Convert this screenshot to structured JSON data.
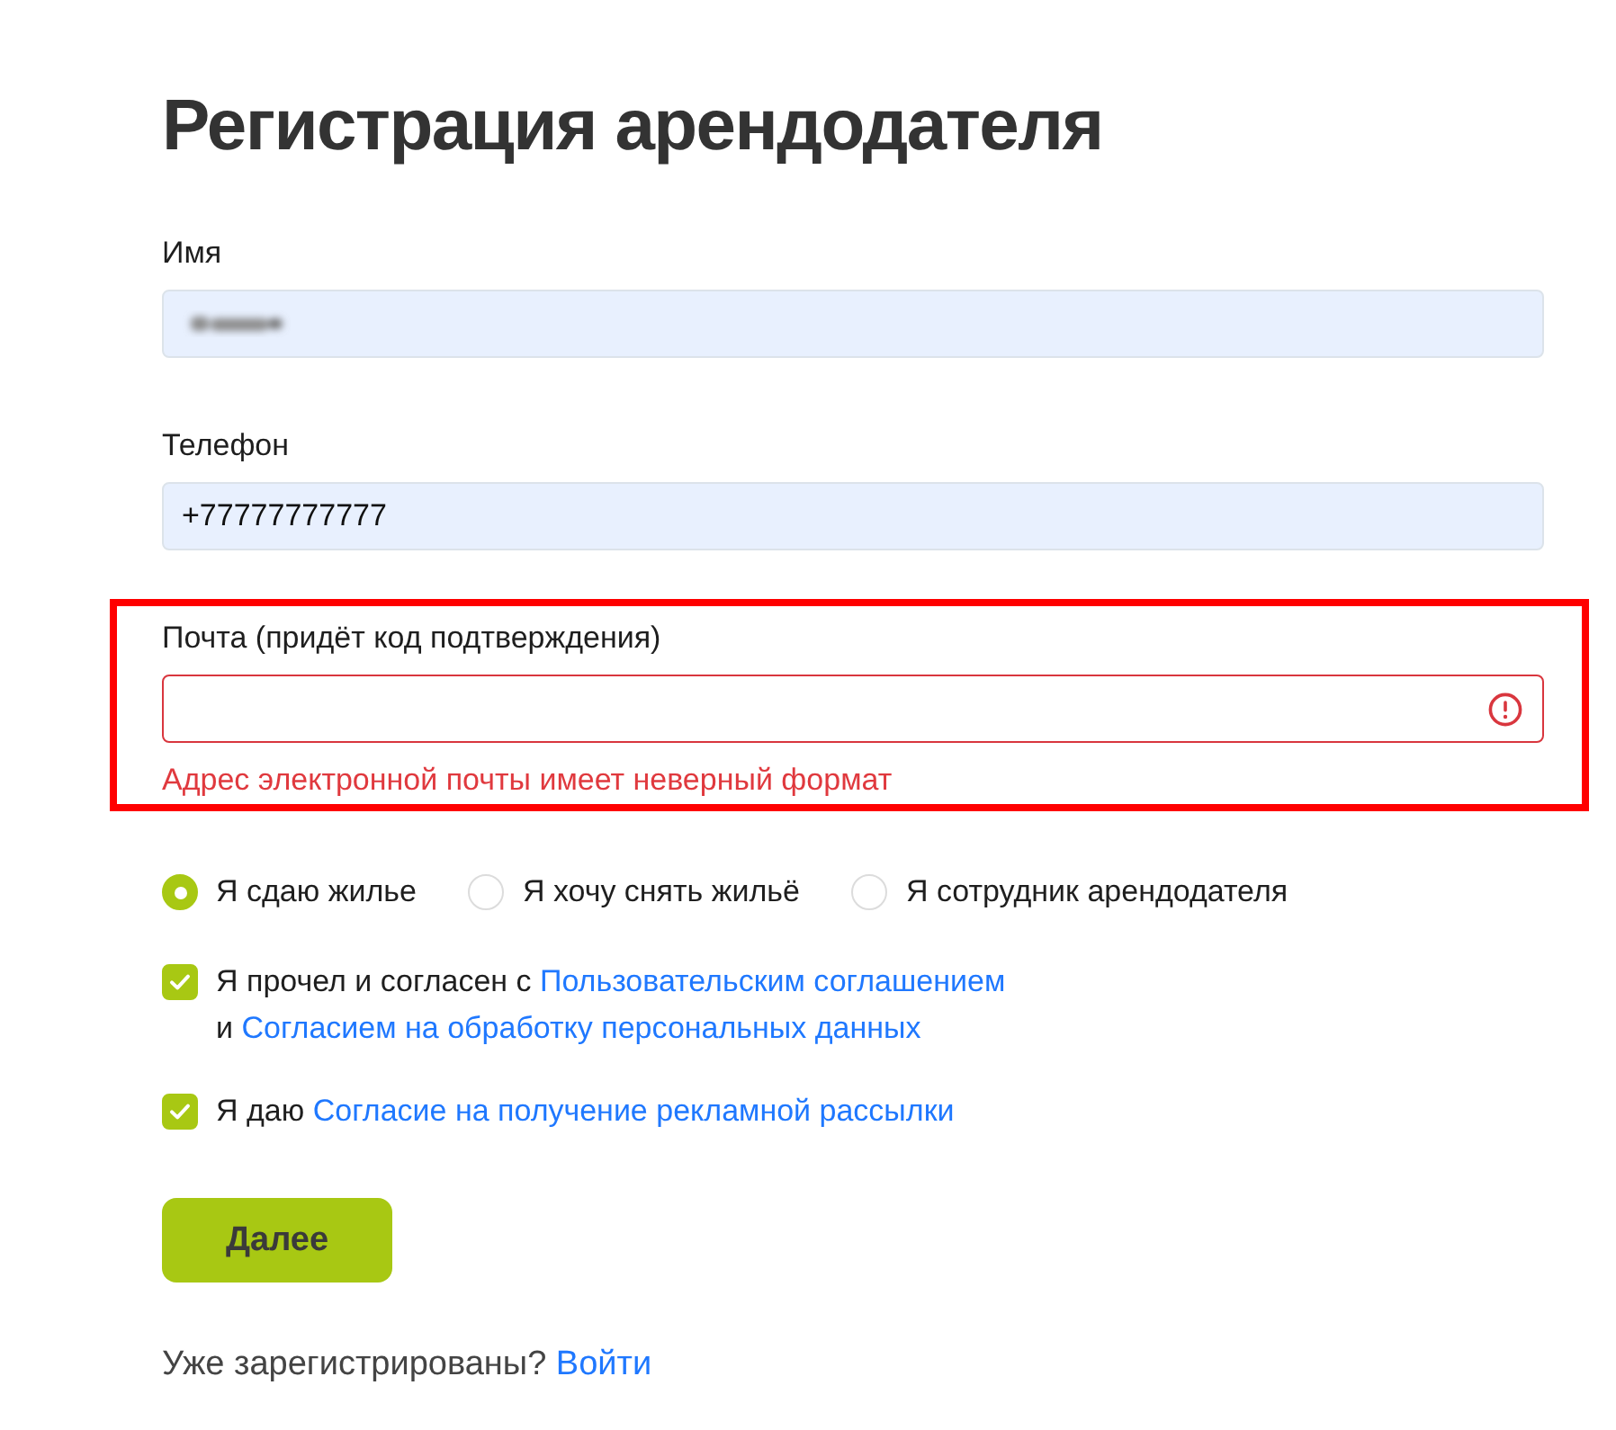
{
  "title": "Регистрация арендодателя",
  "fields": [
    {
      "label": "Имя",
      "autofilled": true,
      "value_blurred": true,
      "invalid": false,
      "highlighted": false
    },
    {
      "label": "Телефон",
      "value": "+77777777777",
      "autofilled": true,
      "value_blurred": false,
      "invalid": false,
      "highlighted": false
    },
    {
      "label": "Почта (придёт код подтверждения)",
      "autofilled": false,
      "value_blurred": false,
      "invalid": true,
      "error": "Адрес электронной почты имеет неверный формат",
      "highlighted": true
    }
  ],
  "roles": [
    {
      "label": "Я сдаю жилье",
      "selected": true
    },
    {
      "label": "Я хочу снять жильё",
      "selected": false
    },
    {
      "label": "Я сотрудник арендодателя",
      "selected": false
    }
  ],
  "agreements": [
    {
      "checked": true,
      "lines": [
        [
          {
            "kind": "text",
            "text": "Я прочел и согласен с"
          },
          {
            "kind": "link",
            "text": "Пользовательским соглашением"
          }
        ],
        [
          {
            "kind": "text",
            "text": "и"
          },
          {
            "kind": "link",
            "text": "Согласием на обработку персональных данных"
          }
        ]
      ]
    },
    {
      "checked": true,
      "lines": [
        [
          {
            "kind": "text",
            "text": "Я даю"
          },
          {
            "kind": "link",
            "text": "Согласие на получение рекламной рассылки"
          }
        ]
      ]
    }
  ],
  "submit": {
    "label": "Далее"
  },
  "footer": {
    "text": "Уже зарегистрированы?",
    "link": "Войти"
  }
}
